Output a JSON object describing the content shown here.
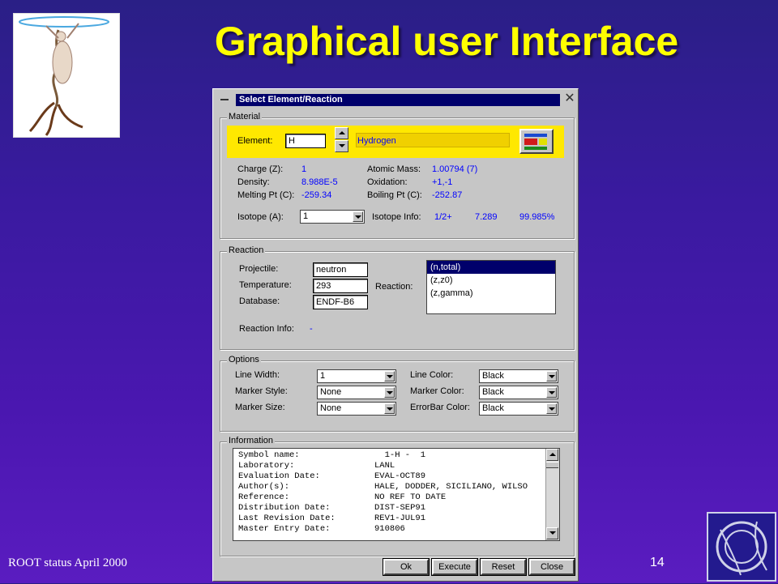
{
  "slide": {
    "title": "Graphical user Interface",
    "footer": "ROOT status April 2000",
    "page_number": "14"
  },
  "dialog": {
    "title": "Select Element/Reaction",
    "material": {
      "legend": "Material",
      "element_label": "Element:",
      "element_value": "H",
      "element_name": "Hydrogen",
      "charge_label": "Charge (Z):",
      "charge_value": "1",
      "density_label": "Density:",
      "density_value": "8.988E-5",
      "melting_label": "Melting Pt (C):",
      "melting_value": "-259.34",
      "atomic_mass_label": "Atomic Mass:",
      "atomic_mass_value": "1.00794 (7)",
      "oxidation_label": "Oxidation:",
      "oxidation_value": "+1,-1",
      "boiling_label": "Boiling Pt (C):",
      "boiling_value": "-252.87",
      "isotope_label": "Isotope (A):",
      "isotope_value": "1",
      "isotope_info_label": "Isotope Info:",
      "isotope_info_spin": "1/2+",
      "isotope_info_mass_excess": "7.289",
      "isotope_info_abundance": "99.985%"
    },
    "reaction": {
      "legend": "Reaction",
      "projectile_label": "Projectile:",
      "projectile_value": "neutron",
      "temperature_label": "Temperature:",
      "temperature_value": "293",
      "database_label": "Database:",
      "database_value": "ENDF-B6",
      "reaction_label": "Reaction:",
      "reactions": [
        "(n,total)",
        "(z,z0)",
        "(z,gamma)"
      ],
      "info_label": "Reaction Info:",
      "info_value": "-"
    },
    "options": {
      "legend": "Options",
      "line_width_label": "Line Width:",
      "line_width_value": "1",
      "marker_style_label": "Marker Style:",
      "marker_style_value": "None",
      "marker_size_label": "Marker Size:",
      "marker_size_value": "None",
      "line_color_label": "Line Color:",
      "line_color_value": "Black",
      "marker_color_label": "Marker Color:",
      "marker_color_value": "Black",
      "errorbar_color_label": "ErrorBar Color:",
      "errorbar_color_value": "Black"
    },
    "information": {
      "legend": "Information",
      "lines": [
        {
          "k": "Symbol name:",
          "v": "  1-H -  1"
        },
        {
          "k": "Laboratory:",
          "v": "LANL"
        },
        {
          "k": "Evaluation Date:",
          "v": "EVAL-OCT89"
        },
        {
          "k": "Author(s):",
          "v": "HALE, DODDER, SICILIANO, WILSO"
        },
        {
          "k": "Reference:",
          "v": "NO REF TO DATE"
        },
        {
          "k": "Distribution Date:",
          "v": "DIST-SEP91"
        },
        {
          "k": "Last Revision Date:",
          "v": "REV1-JUL91"
        },
        {
          "k": "Master Entry Date:",
          "v": "910806"
        }
      ]
    },
    "buttons": {
      "ok": "Ok",
      "execute": "Execute",
      "reset": "Reset",
      "close": "Close"
    }
  },
  "colors": {
    "title_yellow": "#ffff00",
    "value_blue": "#0000ff",
    "highlight_yellow": "#ffe800",
    "selection_navy": "#00006b"
  }
}
